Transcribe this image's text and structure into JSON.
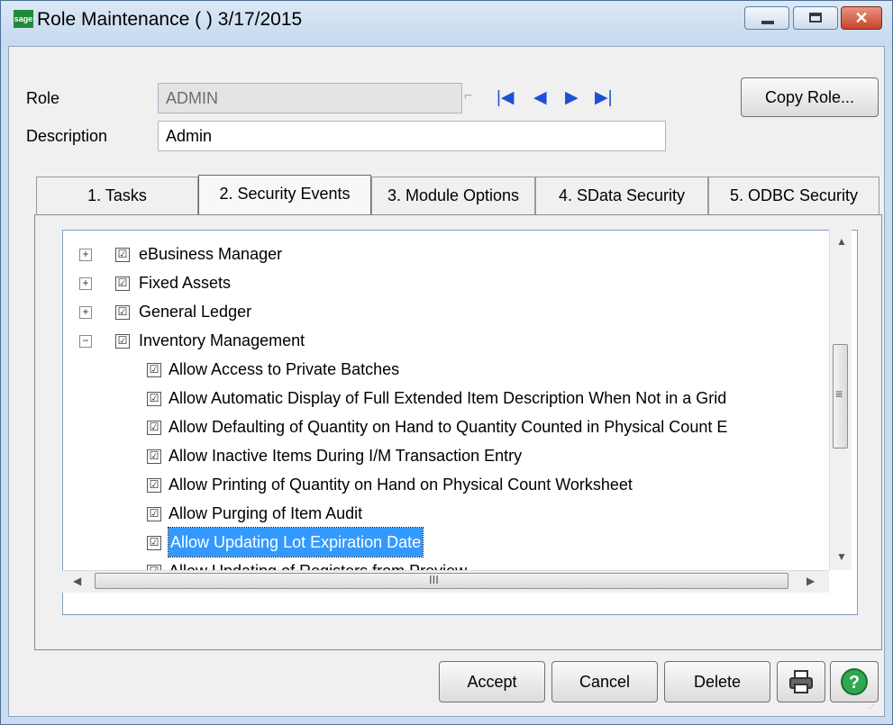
{
  "window": {
    "title": "Role Maintenance (  ) 3/17/2015",
    "logo_text": "sage",
    "minimize_icon": "minimize-icon",
    "maximize_icon": "maximize-icon",
    "close_icon": "close-icon"
  },
  "form": {
    "role_label": "Role",
    "role_value": "ADMIN",
    "description_label": "Description",
    "description_value": "Admin",
    "copy_role_button": "Copy Role..."
  },
  "nav": {
    "first": "|◀",
    "prev": "◀",
    "next": "▶",
    "last": "▶|"
  },
  "tabs": [
    {
      "label": "1. Tasks",
      "active": false
    },
    {
      "label": "2. Security Events",
      "active": true
    },
    {
      "label": "3. Module Options",
      "active": false
    },
    {
      "label": "4. SData Security",
      "active": false
    },
    {
      "label": "5. ODBC Security",
      "active": false
    }
  ],
  "tree": {
    "rows": [
      {
        "label": "eBusiness Manager",
        "expander": "+",
        "checked": "☑"
      },
      {
        "label": "Fixed Assets",
        "expander": "+",
        "checked": "☑"
      },
      {
        "label": "General Ledger",
        "expander": "+",
        "checked": "☑"
      },
      {
        "label": "Inventory Management",
        "expander": "−",
        "checked": "☑"
      },
      {
        "label": "Allow Access to Private Batches",
        "checked": "☑"
      },
      {
        "label": "Allow Automatic Display of Full Extended Item Description When Not in a Grid",
        "checked": "☑"
      },
      {
        "label": "Allow Defaulting of Quantity on Hand to Quantity Counted in Physical Count E",
        "checked": "☑"
      },
      {
        "label": "Allow Inactive Items During I/M Transaction Entry",
        "checked": "☑"
      },
      {
        "label": "Allow Printing of Quantity on Hand on Physical Count Worksheet",
        "checked": "☑"
      },
      {
        "label": "Allow Purging of Item Audit",
        "checked": "☑"
      },
      {
        "label": "Allow Updating Lot Expiration Date",
        "checked": "☑",
        "selected": true
      },
      {
        "label": "Allow Updating of Registers from Preview",
        "checked": "☑"
      }
    ],
    "hscroll_thumb_label": "III",
    "vscroll_thumb_label": "≡"
  },
  "buttons": {
    "accept": "Accept",
    "cancel": "Cancel",
    "delete": "Delete",
    "print_icon": "printer-icon",
    "help_icon": "help-icon"
  }
}
